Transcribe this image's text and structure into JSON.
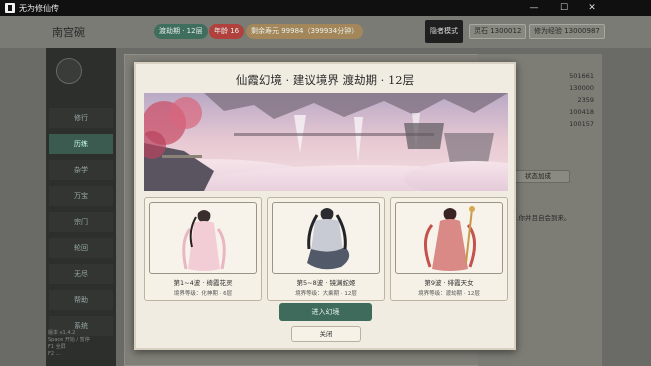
{
  "window": {
    "title": "无为修仙传",
    "minimize": "—",
    "maximize": "☐",
    "close": "✕"
  },
  "topbar": {
    "player_name": "南宫碗",
    "realm_pill": "渡劫期 · 12层",
    "age_pill": "年龄 16",
    "lifespan_pill": "剩余寿元 99984（399934分钟）",
    "hermit_mode": "隐者模式",
    "spirit_stone": "灵石 1300012",
    "cultivation_exp": "修为经验 13000987",
    "colors": {
      "realm": "#3f6e5f",
      "age": "#b0413d",
      "lifespan": "#a3875a"
    }
  },
  "sidebar": {
    "items": [
      {
        "label": "修行"
      },
      {
        "label": "历练"
      },
      {
        "label": "杂学"
      },
      {
        "label": "万宝"
      },
      {
        "label": "宗门"
      },
      {
        "label": "轮回"
      },
      {
        "label": "无尽"
      },
      {
        "label": "帮助"
      },
      {
        "label": "系统"
      }
    ],
    "active_index": 1,
    "version": "版本 v1.4.2",
    "hint1": "Space  开始 / 暂停",
    "hint2": "F1         全屏",
    "hint3": "F2         …"
  },
  "right_panel": {
    "values": [
      "501661",
      "130000",
      "2359",
      "100418",
      "100157"
    ],
    "status_button": "状态加成",
    "note": "…你并且自会到来。"
  },
  "modal": {
    "title": "仙霞幻境  ·  建议境界 渡劫期 · 12层",
    "cards": [
      {
        "wave": "第1~4波 · 绮霞花灵",
        "realm": "境界等级：化神期 · 6层",
        "icon": "pink-fairy"
      },
      {
        "wave": "第5~8波 · 镜渊蛇姬",
        "realm": "境界等级：大乘期 · 12层",
        "icon": "serpent-maiden"
      },
      {
        "wave": "第9波 · 绯霞天女",
        "realm": "境界等级：渡劫期 · 12层",
        "icon": "crimson-goddess"
      }
    ],
    "enter_button": "进入幻境",
    "close_button": "关闭"
  }
}
